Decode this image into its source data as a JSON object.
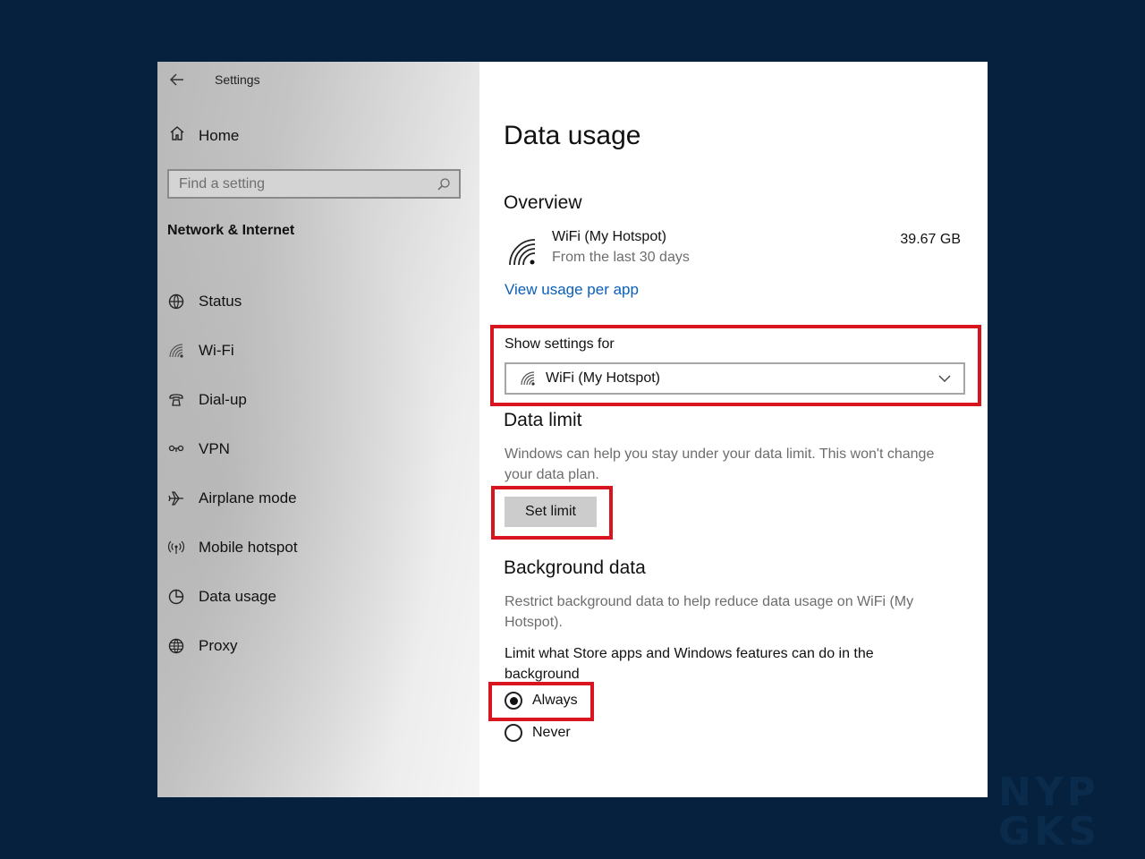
{
  "app": {
    "title": "Settings"
  },
  "sidebar": {
    "home_label": "Home",
    "search_placeholder": "Find a setting",
    "section_heading": "Network & Internet",
    "items": [
      {
        "label": "Status",
        "icon": "status-globe-icon"
      },
      {
        "label": "Wi-Fi",
        "icon": "wifi-icon"
      },
      {
        "label": "Dial-up",
        "icon": "phone-icon"
      },
      {
        "label": "VPN",
        "icon": "vpn-icon"
      },
      {
        "label": "Airplane mode",
        "icon": "airplane-icon"
      },
      {
        "label": "Mobile hotspot",
        "icon": "hotspot-icon"
      },
      {
        "label": "Data usage",
        "icon": "data-usage-icon"
      },
      {
        "label": "Proxy",
        "icon": "globe-icon"
      }
    ]
  },
  "main": {
    "page_title": "Data usage",
    "overview": {
      "heading": "Overview",
      "network_name": "WiFi (My Hotspot)",
      "period": "From the last 30 days",
      "usage": "39.67 GB",
      "link": "View usage per app"
    },
    "show_settings": {
      "label": "Show settings for",
      "selected": "WiFi (My Hotspot)"
    },
    "data_limit": {
      "heading": "Data limit",
      "description": "Windows can help you stay under your data limit. This won't change your data plan.",
      "button": "Set limit"
    },
    "background_data": {
      "heading": "Background data",
      "description": "Restrict background data to help reduce data usage on WiFi (My Hotspot).",
      "question": "Limit what Store apps and Windows features can do in the background",
      "options": [
        {
          "label": "Always",
          "selected": true
        },
        {
          "label": "Never",
          "selected": false
        }
      ]
    }
  },
  "colors": {
    "highlight": "#d8141e",
    "link": "#0b5fb8",
    "backdrop": "#05213d"
  },
  "watermark": "NYP GKS"
}
